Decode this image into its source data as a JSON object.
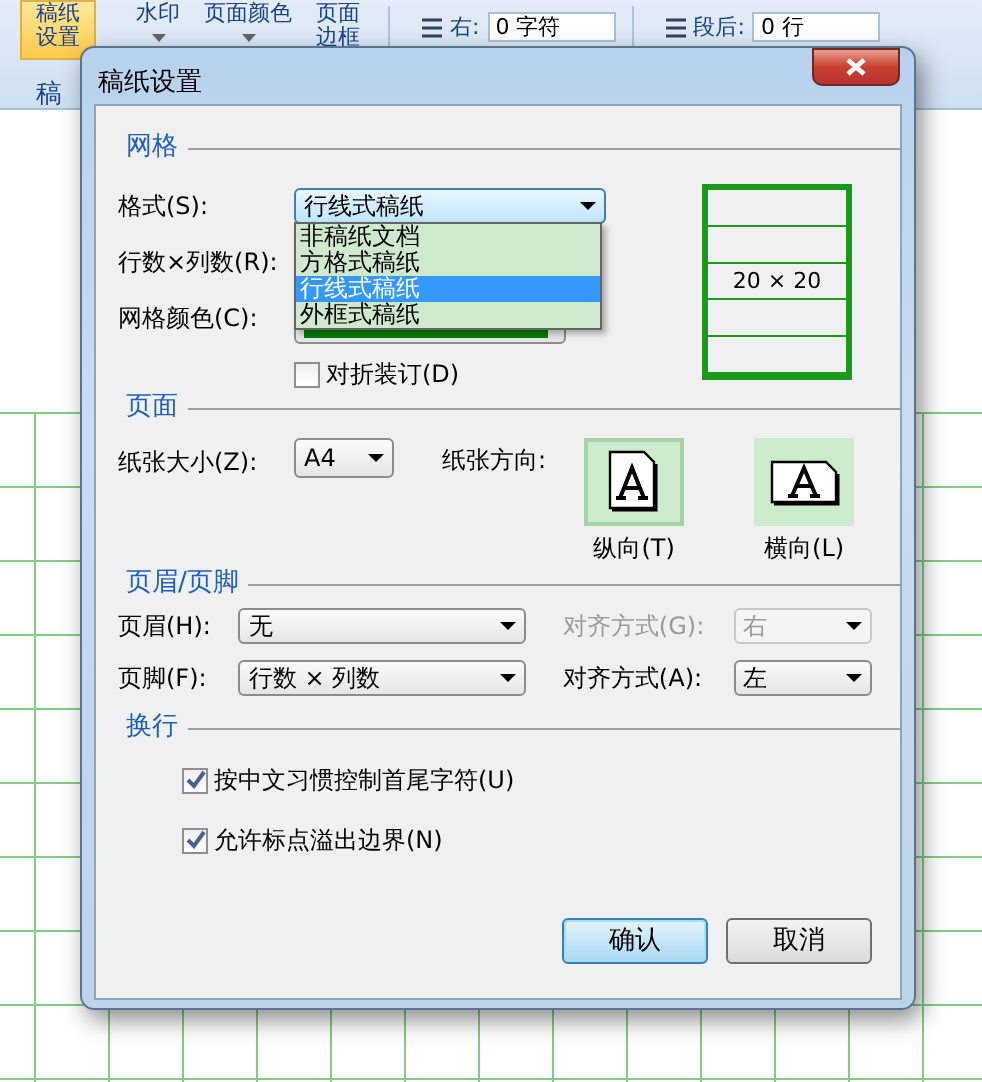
{
  "ribbon": {
    "tools": [
      {
        "kind": "big",
        "lines": [
          "稿纸",
          "设置"
        ],
        "selected": true
      },
      {
        "kind": "caret",
        "lines": [
          "水印"
        ],
        "selected": false
      },
      {
        "kind": "caret",
        "lines": [
          "页面颜色"
        ],
        "selected": false
      },
      {
        "kind": "stack",
        "lines": [
          "页面",
          "边框"
        ],
        "selected": false
      }
    ],
    "group_label": "稿",
    "spacing": [
      {
        "label": "右:",
        "value": "0 字符"
      },
      {
        "label": "段后:",
        "value": "0 行"
      }
    ]
  },
  "dialog": {
    "title": "稿纸设置",
    "grid": {
      "title": "网格",
      "format": {
        "label": "格式(S):",
        "value": "行线式稿纸",
        "expanded": true,
        "options": [
          {
            "label": "非稿纸文档",
            "selected": false
          },
          {
            "label": "方格式稿纸",
            "selected": false
          },
          {
            "label": "行线式稿纸",
            "selected": true
          },
          {
            "label": "外框式稿纸",
            "selected": false
          }
        ]
      },
      "rows_cols": {
        "label": "行数×列数(R):"
      },
      "grid_color": {
        "label": "网格颜色(C):",
        "color": "#008000"
      },
      "fold": {
        "label": "对折装订(D)",
        "checked": false
      },
      "preview": "20 × 20"
    },
    "page": {
      "title": "页面",
      "paper_size": {
        "label": "纸张大小(Z):",
        "value": "A4"
      },
      "orientation_label": "纸张方向:",
      "orientations": [
        {
          "kind": "portrait",
          "label": "纵向(T)",
          "selected": true
        },
        {
          "kind": "landscape",
          "label": "横向(L)",
          "selected": false
        }
      ]
    },
    "header_footer": {
      "title": "页眉/页脚",
      "rows": [
        {
          "label": "页眉(H):",
          "value": "无",
          "align_label": "对齐方式(G):",
          "align_value": "右",
          "disabled": true
        },
        {
          "label": "页脚(F):",
          "value": "行数 × 列数",
          "align_label": "对齐方式(A):",
          "align_value": "左",
          "disabled": false
        }
      ]
    },
    "wrap": {
      "title": "换行",
      "options": [
        {
          "label": "按中文习惯控制首尾字符(U)",
          "checked": true
        },
        {
          "label": "允许标点溢出边界(N)",
          "checked": true
        }
      ]
    },
    "buttons": [
      {
        "label": "确认",
        "default": true
      },
      {
        "label": "取消",
        "default": false
      }
    ]
  }
}
